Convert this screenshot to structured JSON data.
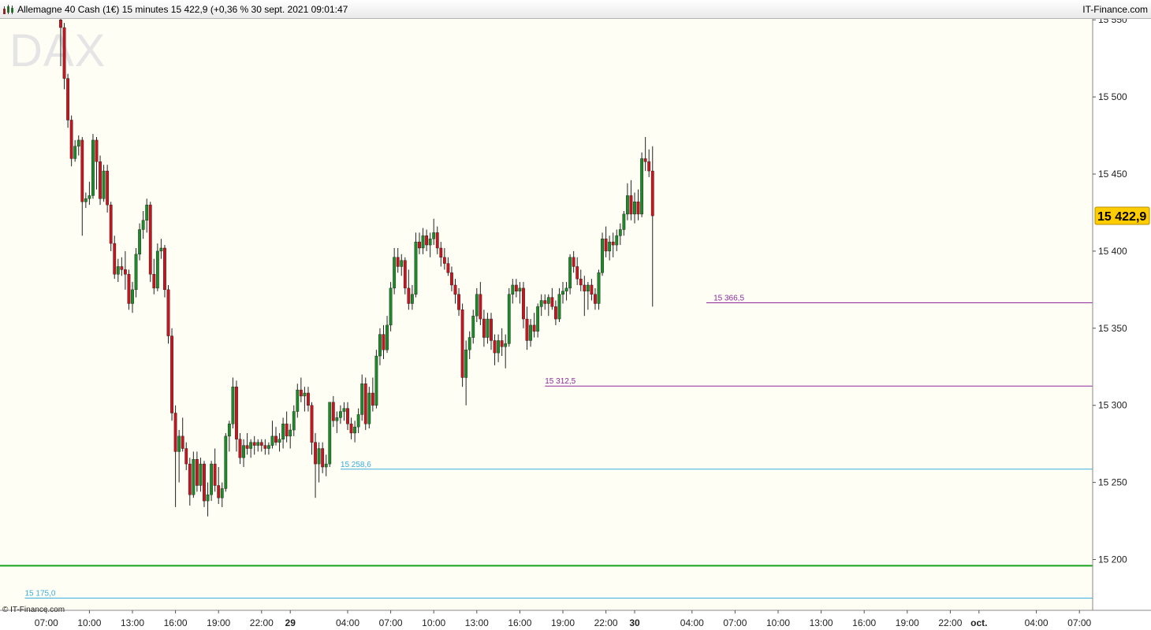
{
  "window": {
    "title": "Allemagne 40 Cash (1€) 15 minutes 15 422,9 (+0,36 % 30 sept. 2021 09:01:47",
    "brand": "IT-Finance.com"
  },
  "watermark": "DAX",
  "copyright": "© IT-Finance.com",
  "colors": {
    "background": "#fffef4",
    "bullish": "#1d8a2a",
    "bearish": "#c8141e",
    "wick": "#222222",
    "resistance": "#8c2a9c",
    "support": "#3aacdf",
    "ma_line": "#18a21e",
    "last_price_badge": "#ffcc00"
  },
  "chart_data": {
    "type": "candlestick",
    "interval": "15 minutes",
    "instrument": "Allemagne 40 Cash (1€)",
    "last_price": 15422.9,
    "last_price_label": "15 422,9",
    "ylim": [
      15160,
      15560
    ],
    "y_ticks": [
      {
        "value": 15550,
        "label": "15 550"
      },
      {
        "value": 15500,
        "label": "15 500"
      },
      {
        "value": 15450,
        "label": "15 450"
      },
      {
        "value": 15400,
        "label": "15 400"
      },
      {
        "value": 15350,
        "label": "15 350"
      },
      {
        "value": 15300,
        "label": "15 300"
      },
      {
        "value": 15250,
        "label": "15 250"
      },
      {
        "value": 15200,
        "label": "15 200"
      }
    ],
    "x_ticks": [
      {
        "bar": -4,
        "label": "07:00",
        "bold": false
      },
      {
        "bar": 8,
        "label": "10:00",
        "bold": false
      },
      {
        "bar": 20,
        "label": "13:00",
        "bold": false
      },
      {
        "bar": 32,
        "label": "16:00",
        "bold": false
      },
      {
        "bar": 44,
        "label": "19:00",
        "bold": false
      },
      {
        "bar": 56,
        "label": "22:00",
        "bold": false
      },
      {
        "bar": 64,
        "label": "29",
        "bold": true
      },
      {
        "bar": 80,
        "label": "04:00",
        "bold": false
      },
      {
        "bar": 92,
        "label": "07:00",
        "bold": false
      },
      {
        "bar": 104,
        "label": "10:00",
        "bold": false
      },
      {
        "bar": 116,
        "label": "13:00",
        "bold": false
      },
      {
        "bar": 128,
        "label": "16:00",
        "bold": false
      },
      {
        "bar": 140,
        "label": "19:00",
        "bold": false
      },
      {
        "bar": 152,
        "label": "22:00",
        "bold": false
      },
      {
        "bar": 160,
        "label": "30",
        "bold": true
      },
      {
        "bar": 176,
        "label": "04:00",
        "bold": false
      },
      {
        "bar": 188,
        "label": "07:00",
        "bold": false
      },
      {
        "bar": 200,
        "label": "10:00",
        "bold": false
      },
      {
        "bar": 212,
        "label": "13:00",
        "bold": false
      },
      {
        "bar": 224,
        "label": "16:00",
        "bold": false
      },
      {
        "bar": 236,
        "label": "19:00",
        "bold": false
      },
      {
        "bar": 248,
        "label": "22:00",
        "bold": false
      },
      {
        "bar": 256,
        "label": "oct.",
        "bold": true
      },
      {
        "bar": 272,
        "label": "04:00",
        "bold": false
      },
      {
        "bar": 284,
        "label": "07:00",
        "bold": false
      }
    ],
    "levels": [
      {
        "value": 15366.5,
        "label": "15 366,5",
        "kind": "resistance",
        "from_bar": 180,
        "label_bar": 182
      },
      {
        "value": 15312.5,
        "label": "15 312,5",
        "kind": "resistance",
        "from_bar": 135,
        "label_bar": 135
      },
      {
        "value": 15258.6,
        "label": "15 258,6",
        "kind": "support",
        "from_bar": 78,
        "label_bar": 78
      },
      {
        "value": 15175.0,
        "label": "15 175,0",
        "kind": "support",
        "from_bar": -10,
        "label_bar": -10
      }
    ],
    "ma_level": 15196,
    "ohlc": [
      [
        15550,
        15552,
        15520,
        15545
      ],
      [
        15545,
        15548,
        15505,
        15512
      ],
      [
        15512,
        15515,
        15480,
        15485
      ],
      [
        15485,
        15488,
        15455,
        15460
      ],
      [
        15460,
        15472,
        15458,
        15468
      ],
      [
        15468,
        15475,
        15462,
        15472
      ],
      [
        15472,
        15474,
        15410,
        15432
      ],
      [
        15432,
        15438,
        15428,
        15434
      ],
      [
        15434,
        15445,
        15430,
        15436
      ],
      [
        15436,
        15476,
        15434,
        15472
      ],
      [
        15472,
        15474,
        15440,
        15458
      ],
      [
        15458,
        15462,
        15430,
        15434
      ],
      [
        15434,
        15456,
        15432,
        15452
      ],
      [
        15452,
        15456,
        15425,
        15430
      ],
      [
        15430,
        15432,
        15400,
        15405
      ],
      [
        15405,
        15410,
        15382,
        15385
      ],
      [
        15385,
        15395,
        15380,
        15390
      ],
      [
        15390,
        15396,
        15384,
        15388
      ],
      [
        15388,
        15400,
        15375,
        15385
      ],
      [
        15385,
        15388,
        15362,
        15366
      ],
      [
        15366,
        15380,
        15360,
        15375
      ],
      [
        15375,
        15402,
        15370,
        15398
      ],
      [
        15398,
        15418,
        15394,
        15414
      ],
      [
        15414,
        15426,
        15408,
        15420
      ],
      [
        15420,
        15434,
        15412,
        15430
      ],
      [
        15430,
        15432,
        15380,
        15385
      ],
      [
        15385,
        15395,
        15372,
        15376
      ],
      [
        15376,
        15405,
        15374,
        15400
      ],
      [
        15400,
        15408,
        15395,
        15402
      ],
      [
        15402,
        15404,
        15370,
        15375
      ],
      [
        15375,
        15378,
        15340,
        15345
      ],
      [
        15345,
        15350,
        15290,
        15295
      ],
      [
        15295,
        15300,
        15234,
        15270
      ],
      [
        15270,
        15284,
        15250,
        15280
      ],
      [
        15280,
        15292,
        15270,
        15272
      ],
      [
        15272,
        15276,
        15258,
        15262
      ],
      [
        15262,
        15266,
        15235,
        15242
      ],
      [
        15242,
        15270,
        15240,
        15265
      ],
      [
        15265,
        15270,
        15244,
        15248
      ],
      [
        15248,
        15266,
        15244,
        15262
      ],
      [
        15262,
        15264,
        15234,
        15238
      ],
      [
        15238,
        15250,
        15228,
        15242
      ],
      [
        15242,
        15264,
        15238,
        15262
      ],
      [
        15262,
        15272,
        15244,
        15248
      ],
      [
        15248,
        15260,
        15236,
        15240
      ],
      [
        15240,
        15250,
        15234,
        15246
      ],
      [
        15246,
        15282,
        15244,
        15280
      ],
      [
        15280,
        15290,
        15270,
        15288
      ],
      [
        15288,
        15318,
        15285,
        15312
      ],
      [
        15312,
        15316,
        15270,
        15278
      ],
      [
        15278,
        15282,
        15262,
        15266
      ],
      [
        15266,
        15278,
        15260,
        15274
      ],
      [
        15274,
        15282,
        15268,
        15272
      ],
      [
        15272,
        15278,
        15266,
        15276
      ],
      [
        15276,
        15280,
        15268,
        15274
      ],
      [
        15274,
        15278,
        15270,
        15276
      ],
      [
        15276,
        15278,
        15270,
        15274
      ],
      [
        15274,
        15278,
        15268,
        15272
      ],
      [
        15272,
        15276,
        15268,
        15274
      ],
      [
        15274,
        15290,
        15272,
        15280
      ],
      [
        15280,
        15286,
        15274,
        15276
      ],
      [
        15276,
        15282,
        15270,
        15278
      ],
      [
        15278,
        15292,
        15272,
        15288
      ],
      [
        15288,
        15296,
        15276,
        15280
      ],
      [
        15280,
        15288,
        15272,
        15284
      ],
      [
        15284,
        15300,
        15280,
        15296
      ],
      [
        15296,
        15314,
        15292,
        15310
      ],
      [
        15310,
        15318,
        15302,
        15306
      ],
      [
        15306,
        15312,
        15296,
        15308
      ],
      [
        15308,
        15312,
        15296,
        15300
      ],
      [
        15300,
        15302,
        15268,
        15276
      ],
      [
        15276,
        15282,
        15240,
        15262
      ],
      [
        15262,
        15276,
        15250,
        15272
      ],
      [
        15272,
        15276,
        15256,
        15260
      ],
      [
        15260,
        15268,
        15254,
        15262
      ],
      [
        15262,
        15302,
        15260,
        15302
      ],
      [
        15302,
        15306,
        15286,
        15290
      ],
      [
        15290,
        15296,
        15282,
        15292
      ],
      [
        15292,
        15300,
        15288,
        15296
      ],
      [
        15296,
        15302,
        15290,
        15298
      ],
      [
        15298,
        15302,
        15284,
        15288
      ],
      [
        15288,
        15292,
        15278,
        15282
      ],
      [
        15282,
        15290,
        15276,
        15286
      ],
      [
        15286,
        15298,
        15282,
        15294
      ],
      [
        15294,
        15320,
        15290,
        15314
      ],
      [
        15314,
        15318,
        15284,
        15288
      ],
      [
        15288,
        15312,
        15285,
        15308
      ],
      [
        15308,
        15318,
        15296,
        15300
      ],
      [
        15300,
        15336,
        15298,
        15332
      ],
      [
        15332,
        15350,
        15326,
        15346
      ],
      [
        15346,
        15352,
        15330,
        15336
      ],
      [
        15336,
        15358,
        15334,
        15352
      ],
      [
        15352,
        15380,
        15348,
        15376
      ],
      [
        15376,
        15402,
        15372,
        15396
      ],
      [
        15396,
        15402,
        15386,
        15390
      ],
      [
        15390,
        15398,
        15384,
        15394
      ],
      [
        15394,
        15396,
        15372,
        15376
      ],
      [
        15376,
        15388,
        15362,
        15366
      ],
      [
        15366,
        15378,
        15362,
        15372
      ],
      [
        15372,
        15412,
        15370,
        15406
      ],
      [
        15406,
        15412,
        15398,
        15402
      ],
      [
        15402,
        15415,
        15398,
        15410
      ],
      [
        15410,
        15414,
        15400,
        15404
      ],
      [
        15404,
        15412,
        15396,
        15408
      ],
      [
        15408,
        15421,
        15404,
        15412
      ],
      [
        15412,
        15416,
        15398,
        15402
      ],
      [
        15402,
        15406,
        15390,
        15396
      ],
      [
        15396,
        15402,
        15388,
        15392
      ],
      [
        15392,
        15396,
        15384,
        15386
      ],
      [
        15386,
        15390,
        15374,
        15378
      ],
      [
        15378,
        15382,
        15366,
        15372
      ],
      [
        15372,
        15376,
        15358,
        15362
      ],
      [
        15362,
        15366,
        15312,
        15318
      ],
      [
        15318,
        15342,
        15300,
        15336
      ],
      [
        15336,
        15348,
        15330,
        15344
      ],
      [
        15344,
        15362,
        15340,
        15358
      ],
      [
        15358,
        15376,
        15354,
        15372
      ],
      [
        15372,
        15380,
        15352,
        15356
      ],
      [
        15356,
        15362,
        15338,
        15344
      ],
      [
        15344,
        15360,
        15340,
        15356
      ],
      [
        15356,
        15360,
        15336,
        15342
      ],
      [
        15342,
        15346,
        15326,
        15334
      ],
      [
        15334,
        15346,
        15328,
        15342
      ],
      [
        15342,
        15350,
        15332,
        15338
      ],
      [
        15338,
        15346,
        15324,
        15340
      ],
      [
        15340,
        15376,
        15338,
        15372
      ],
      [
        15372,
        15382,
        15366,
        15378
      ],
      [
        15378,
        15382,
        15370,
        15374
      ],
      [
        15374,
        15380,
        15366,
        15376
      ],
      [
        15376,
        15380,
        15350,
        15356
      ],
      [
        15356,
        15364,
        15336,
        15342
      ],
      [
        15342,
        15356,
        15338,
        15352
      ],
      [
        15352,
        15360,
        15344,
        15348
      ],
      [
        15348,
        15366,
        15344,
        15364
      ],
      [
        15364,
        15372,
        15358,
        15368
      ],
      [
        15368,
        15372,
        15362,
        15366
      ],
      [
        15366,
        15372,
        15358,
        15370
      ],
      [
        15370,
        15376,
        15362,
        15364
      ],
      [
        15364,
        15368,
        15352,
        15356
      ],
      [
        15356,
        15376,
        15354,
        15372
      ],
      [
        15372,
        15380,
        15366,
        15374
      ],
      [
        15374,
        15380,
        15368,
        15376
      ],
      [
        15376,
        15398,
        15372,
        15396
      ],
      [
        15396,
        15400,
        15386,
        15390
      ],
      [
        15390,
        15396,
        15378,
        15382
      ],
      [
        15382,
        15388,
        15374,
        15378
      ],
      [
        15378,
        15384,
        15358,
        15374
      ],
      [
        15374,
        15380,
        15362,
        15378
      ],
      [
        15378,
        15382,
        15368,
        15372
      ],
      [
        15372,
        15376,
        15362,
        15366
      ],
      [
        15366,
        15388,
        15362,
        15386
      ],
      [
        15386,
        15412,
        15384,
        15408
      ],
      [
        15408,
        15416,
        15396,
        15400
      ],
      [
        15400,
        15410,
        15394,
        15406
      ],
      [
        15406,
        15412,
        15396,
        15404
      ],
      [
        15404,
        15414,
        15400,
        15410
      ],
      [
        15410,
        15418,
        15404,
        15414
      ],
      [
        15414,
        15426,
        15410,
        15424
      ],
      [
        15424,
        15444,
        15420,
        15436
      ],
      [
        15436,
        15446,
        15420,
        15424
      ],
      [
        15424,
        15438,
        15418,
        15432
      ],
      [
        15432,
        15440,
        15420,
        15424
      ],
      [
        15424,
        15464,
        15422,
        15460
      ],
      [
        15460,
        15474,
        15452,
        15458
      ],
      [
        15458,
        15466,
        15448,
        15452
      ],
      [
        15452,
        15468,
        15364,
        15422.9
      ]
    ]
  }
}
